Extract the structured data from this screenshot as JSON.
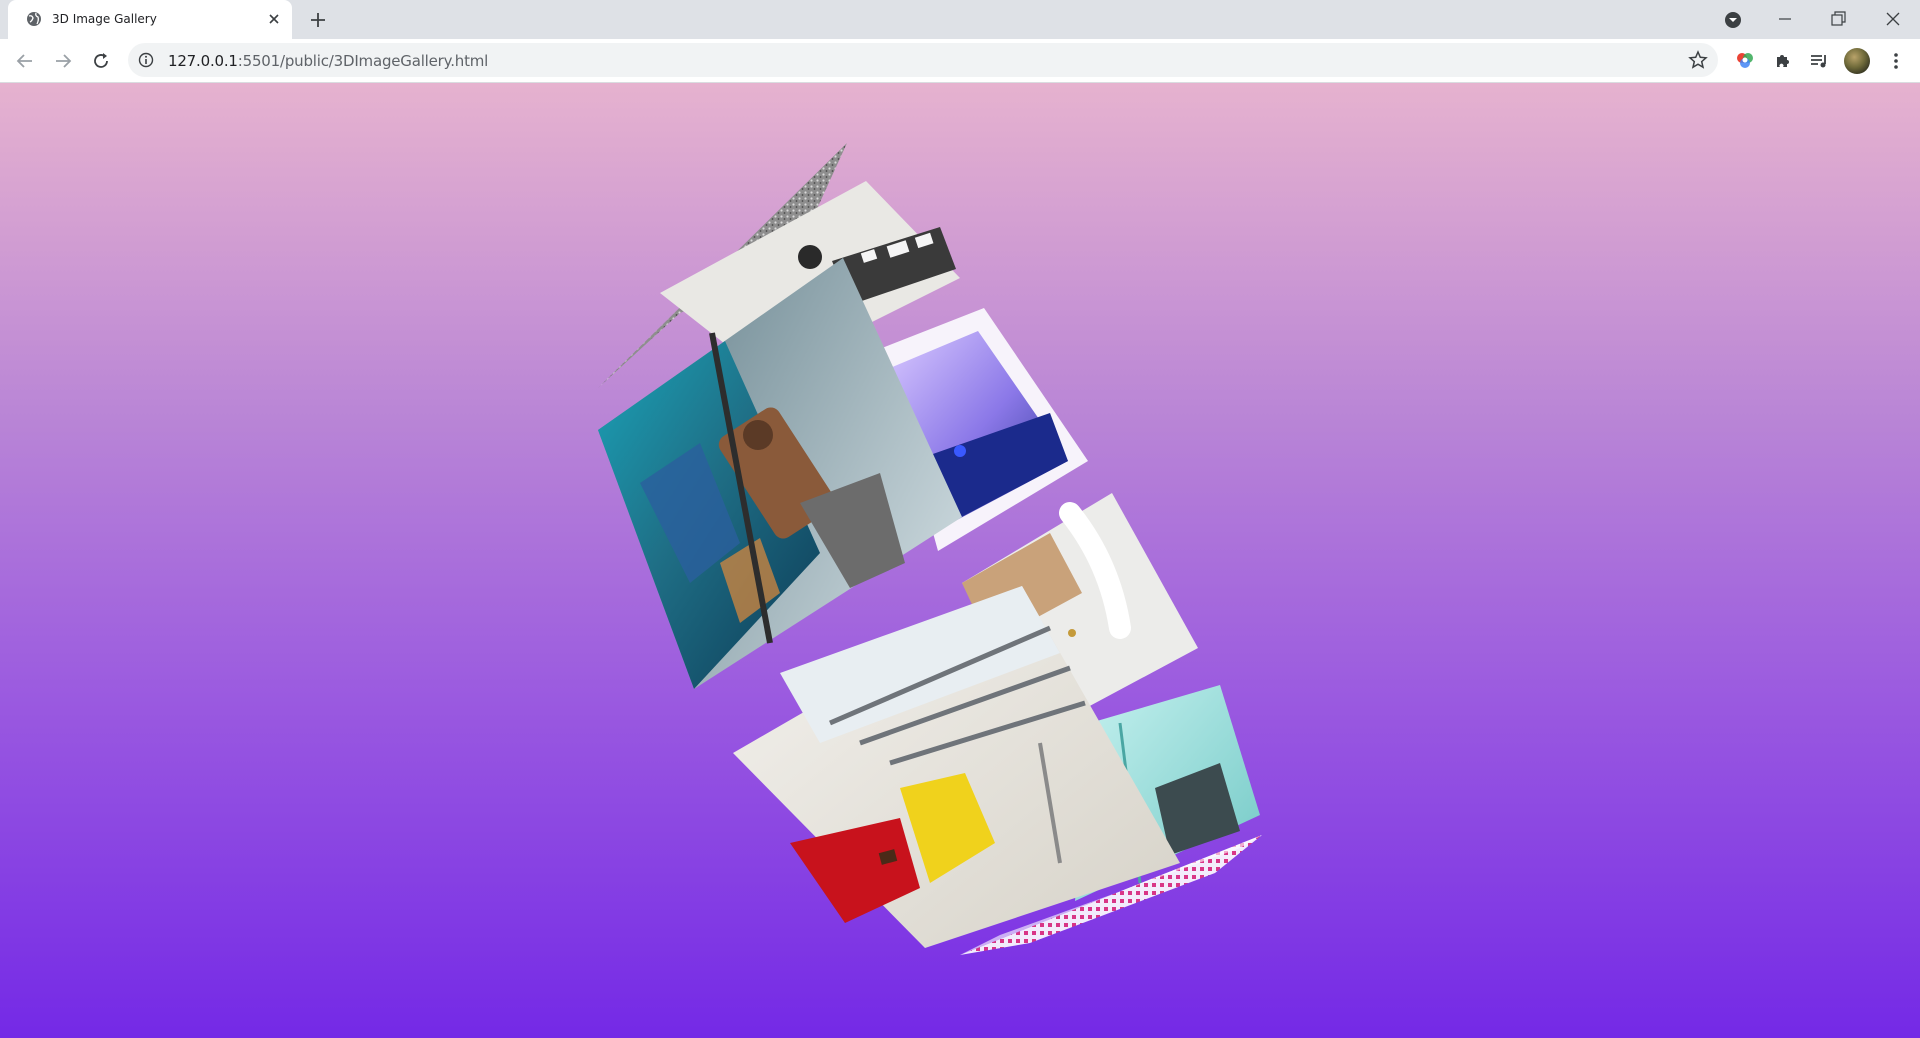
{
  "browser": {
    "tab": {
      "title": "3D Image Gallery"
    },
    "address_bar": {
      "host": "127.0.0.1",
      "path": ":5501/public/3DImageGallery.html"
    }
  },
  "icons": {
    "favicon": "globe-icon",
    "tab_close": "close-icon",
    "new_tab": "plus-icon",
    "back": "back-arrow-icon",
    "forward": "forward-arrow-icon",
    "reload": "reload-icon",
    "site_info": "info-icon",
    "bookmark": "star-icon",
    "extensions": "puzzle-icon",
    "media": "playlist-icon",
    "menu": "more-vert-icon"
  },
  "colors": {
    "page_top": "#e6b2cf",
    "page_bottom": "#7429e6",
    "tabstrip": "#dee1e6"
  },
  "gallery": {
    "photos": [
      {
        "id": "photo-gallery-room",
        "subject": "gallery wall with framed photos"
      },
      {
        "id": "photo-muralist",
        "subject": "man painting a mural"
      },
      {
        "id": "photo-light-installation",
        "subject": "blue light installation"
      },
      {
        "id": "photo-sculpture-room",
        "subject": "white sculpture in room"
      },
      {
        "id": "photo-museum-hall",
        "subject": "museum hall with red and yellow walls"
      },
      {
        "id": "photo-glass-wall",
        "subject": "teal glass wall exhibition"
      },
      {
        "id": "photo-textured-gray",
        "subject": "gray textured surface"
      },
      {
        "id": "photo-pink-pattern",
        "subject": "pink pattern"
      }
    ]
  }
}
